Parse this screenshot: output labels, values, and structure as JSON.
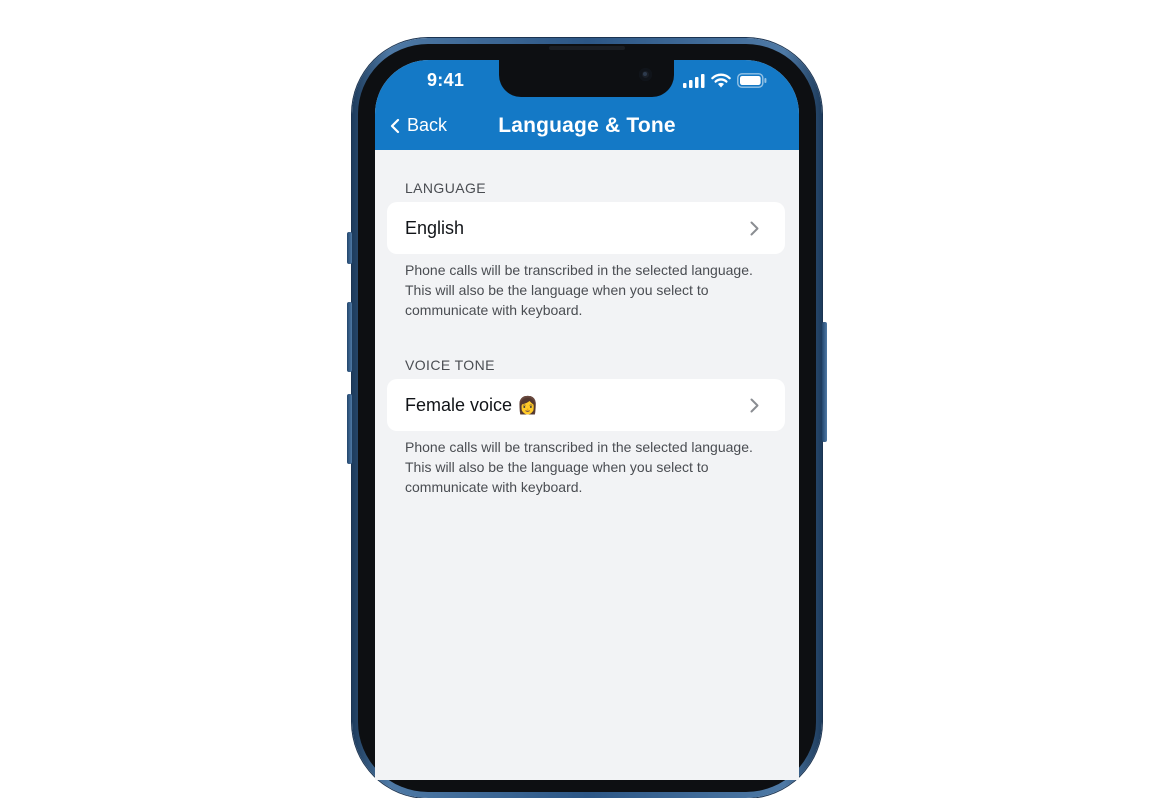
{
  "status_bar": {
    "time": "9:41"
  },
  "nav": {
    "back_label": "Back",
    "title": "Language & Tone"
  },
  "sections": [
    {
      "label": "LANGUAGE",
      "value": "English",
      "help": "Phone calls will be transcribed in the selected language. This will also be the language when you select to communicate with keyboard."
    },
    {
      "label": "VOICE TONE",
      "value": "Female voice",
      "value_emoji": "👩",
      "help": "Phone calls will be transcribed in the selected language. This will also be the language when you select to communicate with keyboard."
    }
  ],
  "icons": {
    "signal": "signal-icon",
    "wifi": "wifi-icon",
    "battery": "battery-icon",
    "back": "chevron-left-icon",
    "row_disclosure": "chevron-right-icon"
  },
  "colors": {
    "header": "#1479c6",
    "screen_bg": "#f2f3f5",
    "row_bg": "#ffffff",
    "frame": "#2c5685"
  }
}
